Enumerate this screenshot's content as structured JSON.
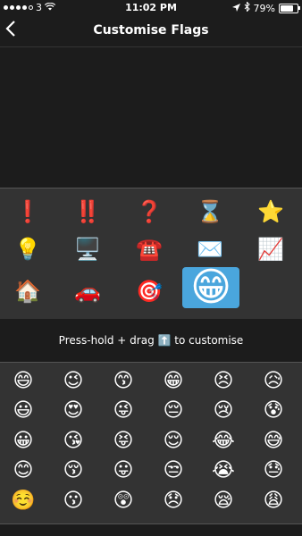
{
  "status": {
    "carrier": "3",
    "time": "11:02 PM",
    "battery": "79%",
    "battery_level": 0.79
  },
  "nav": {
    "title": "Customise Flags",
    "back_icon": "chevron-left"
  },
  "flags": [
    {
      "name": "exclamation-mark",
      "glyph": "❗"
    },
    {
      "name": "double-exclamation",
      "glyph": "‼️"
    },
    {
      "name": "question-mark",
      "glyph": "❓"
    },
    {
      "name": "hourglass",
      "glyph": "⌛"
    },
    {
      "name": "star",
      "glyph": "⭐"
    },
    {
      "name": "light-bulb",
      "glyph": "💡"
    },
    {
      "name": "computer",
      "glyph": "🖥️"
    },
    {
      "name": "telephone",
      "glyph": "☎️"
    },
    {
      "name": "envelope",
      "glyph": "✉️"
    },
    {
      "name": "chart-increasing",
      "glyph": "📈"
    },
    {
      "name": "house",
      "glyph": "🏠"
    },
    {
      "name": "car",
      "glyph": "🚗"
    },
    {
      "name": "target",
      "glyph": "🎯"
    },
    {
      "name": "grinning-face-selected",
      "glyph": "😁",
      "selected": true
    }
  ],
  "hint": {
    "text_before": "Press-hold + drag",
    "icon": "⬆️",
    "text_after": "to customise"
  },
  "emoji_grid": [
    [
      "😄",
      "😉",
      "😙",
      "😁",
      "😣",
      "😥"
    ],
    [
      "😃",
      "😍",
      "😜",
      "😔",
      "😢",
      "😰"
    ],
    [
      "😀",
      "😘",
      "😝",
      "😌",
      "😂",
      "😅"
    ],
    [
      "😊",
      "😚",
      "😛",
      "😒",
      "😭",
      "😓"
    ],
    [
      "☺️",
      "😗",
      "😲",
      "😞",
      "😪",
      "😩"
    ]
  ]
}
